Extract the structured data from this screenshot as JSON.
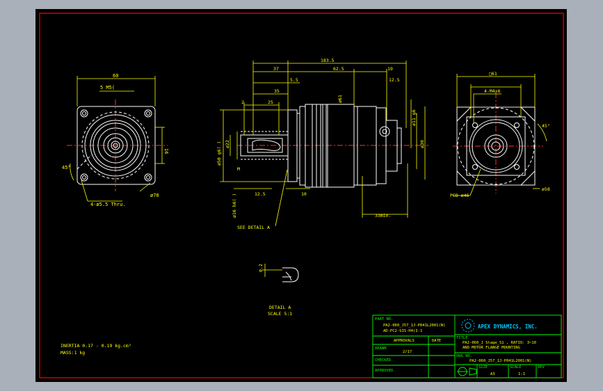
{
  "colors": {
    "background_outer": "#a9b0b9",
    "canvas": "#000000",
    "border": "#ff0000",
    "geometry": "#ffffff",
    "dimensions": "#ffff00",
    "center_lines": "#ff3030",
    "title_block": "#00ff00",
    "logo": "#00c8ff"
  },
  "front_view": {
    "dim_top": "60",
    "dim_tap": "5 M5(",
    "dim_side": "16",
    "angle": "45°",
    "hole_note": "4-ø5.5 Thru.",
    "diameter": "ø70"
  },
  "side_view": {
    "total_length": "183.5",
    "dim_37": "37",
    "dim_625": "62.5",
    "dim_19": "19",
    "dim_35": "35",
    "dim_5": "5.5",
    "dim_2": "2",
    "dim_25a": "25",
    "dim_125": "12.5",
    "dim_125b": "12.5",
    "dim_10": "10",
    "dim_22": "ø22",
    "dim_50": "ø50 g6(  )",
    "dim_16": "ø16 h6(  )",
    "dim_61": "ø61",
    "dim_30": "ø30",
    "dim_11": "ø11 g6",
    "dim_33": "33min.",
    "dim_m": "M",
    "detail_ref": "SEE DETAIL A"
  },
  "end_view": {
    "dim_top": "□61",
    "dim_holes": "4-M4x6",
    "angle": "45°",
    "pcd": "PCD ø46",
    "diameter": "ø58"
  },
  "detail": {
    "dim": "0.2",
    "label": "DETAIL A",
    "scale": "SCALE 5:1"
  },
  "notes": {
    "inertia": "INERTIA 0.17 - 0.19 kg.cm²",
    "mass": "MASS:1 kg"
  },
  "title_block": {
    "part_no_label": "PART NO.",
    "part_no_1": "PA2-060_J57_1J-P041L2001(N)",
    "part_no_2": "AD-PC2-S31-H4(I-1",
    "company": "APEX DYNAMICS, INC.",
    "approvals": "APPROVALS",
    "date": "DATE",
    "drawn": "DRAWN",
    "drawn_val": "2/17",
    "checked": "CHECKED",
    "approved": "APPROVED",
    "title_label": "TITLE",
    "title_1": "PA2-060_J Stage_S1 , RATIO: 3~10",
    "title_2": "AND MOTOR FLANGE MOUNTING",
    "dwg_no_label": "DWG NO.",
    "dwg_no": "PA2-060_J57_1J-P041L2001(N)",
    "size_label": "SIZE",
    "size": "A3",
    "scale_label": "SCALE",
    "scale": "1:1",
    "rev_label": "REV"
  }
}
